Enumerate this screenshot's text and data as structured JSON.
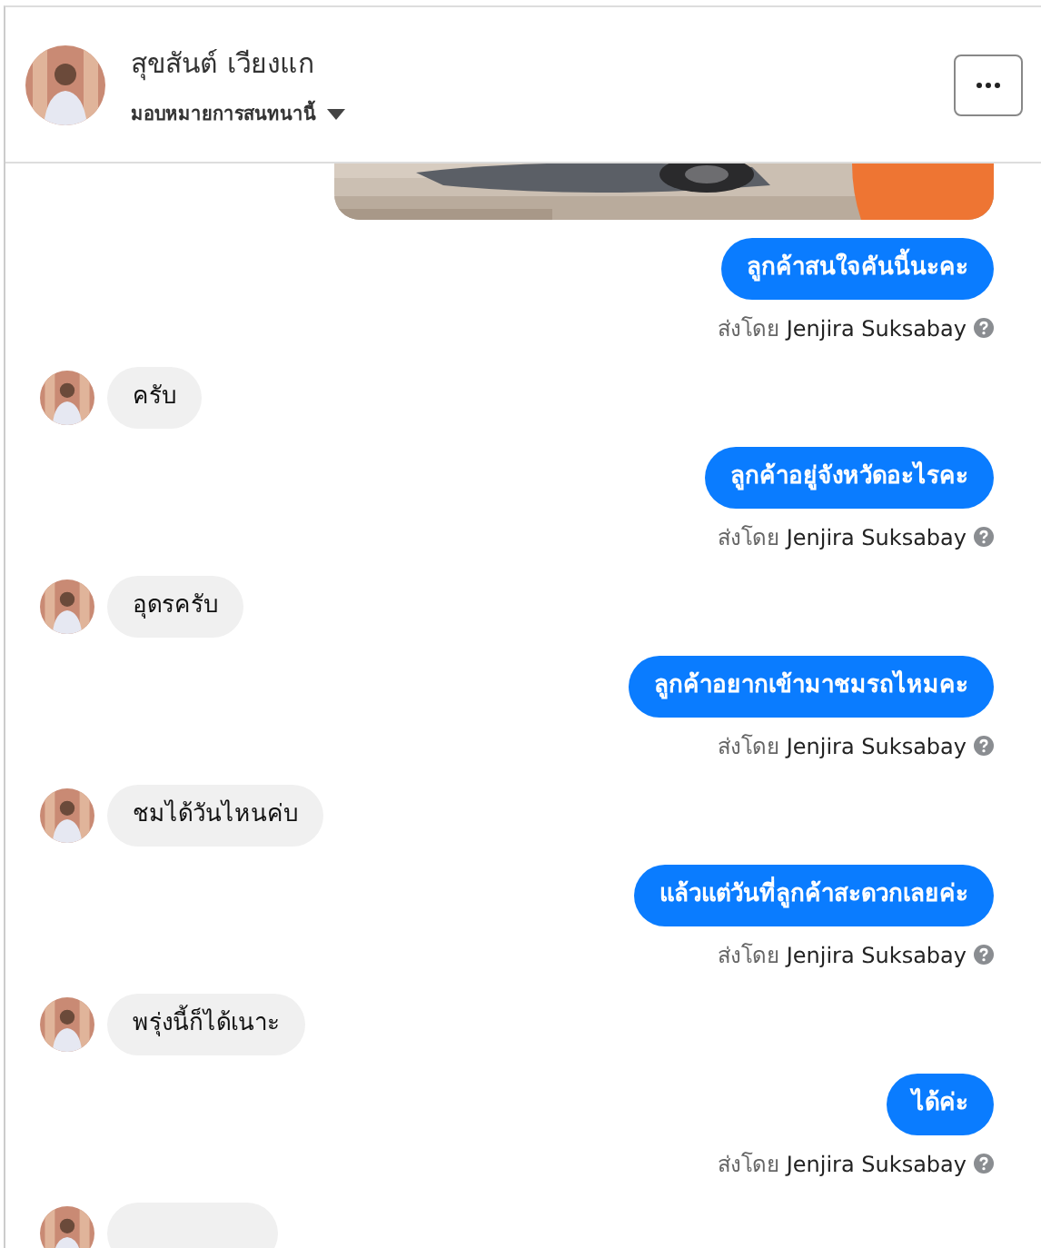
{
  "header": {
    "name": "สุขสันต์ เวียงแก",
    "subtitle": "มอบหมายการสนทนานี้"
  },
  "messages": [
    {
      "kind": "outgoing",
      "text": "ลูกค้าสนใจคันนี้นะคะ",
      "sent_by_label": "ส่งโดย",
      "sender": "Jenjira Suksabay"
    },
    {
      "kind": "incoming",
      "text": "ครับ"
    },
    {
      "kind": "outgoing",
      "text": "ลูกค้าอยู่จังหวัดอะไรคะ",
      "sent_by_label": "ส่งโดย",
      "sender": "Jenjira Suksabay"
    },
    {
      "kind": "incoming",
      "text": "อุดรครับ"
    },
    {
      "kind": "outgoing",
      "text": "ลูกค้าอยากเข้ามาชมรถไหมคะ",
      "sent_by_label": "ส่งโดย",
      "sender": "Jenjira Suksabay"
    },
    {
      "kind": "incoming",
      "text": "ชมได้วันไหนค่บ"
    },
    {
      "kind": "outgoing",
      "text": "แล้วแต่วันที่ลูกค้าสะดวกเลยค่ะ",
      "sent_by_label": "ส่งโดย",
      "sender": "Jenjira Suksabay"
    },
    {
      "kind": "incoming",
      "text": "พรุ่งนี้ก็ได้เนาะ"
    },
    {
      "kind": "outgoing",
      "text": "ได้ค่ะ",
      "sent_by_label": "ส่งโดย",
      "sender": "Jenjira Suksabay"
    },
    {
      "kind": "incoming"
    }
  ]
}
